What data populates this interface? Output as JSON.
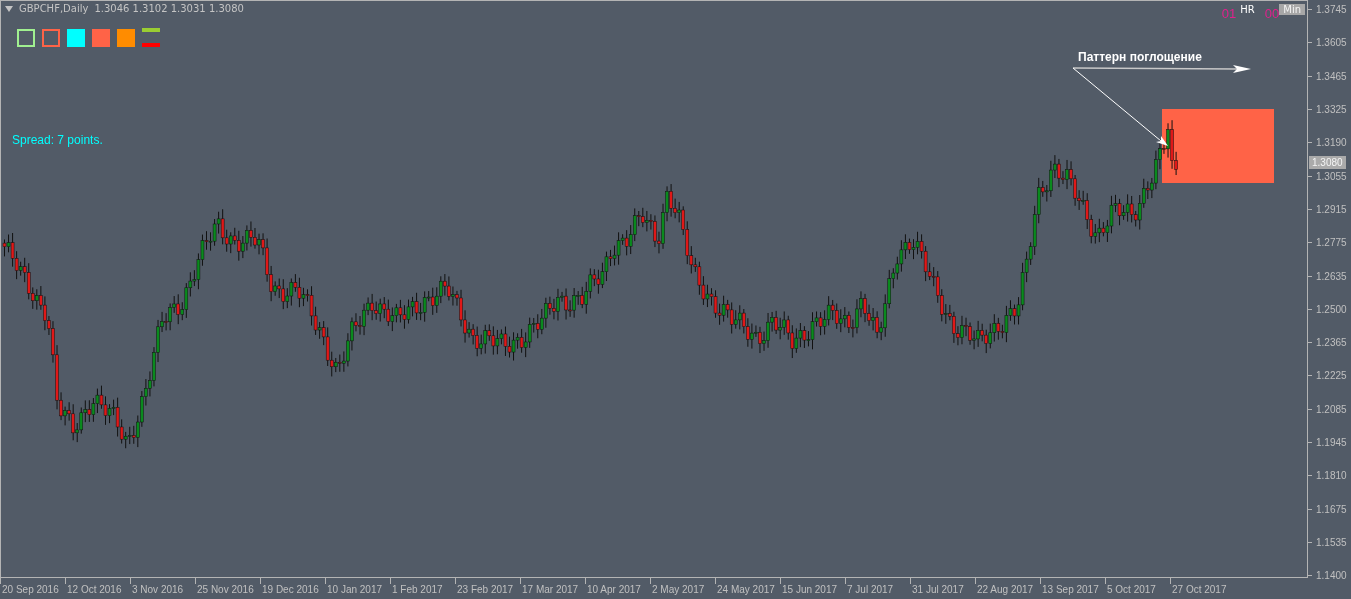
{
  "chart": {
    "symbol": "GBPCHF,Daily",
    "ohlc": "1.3046 1.3102 1.3031 1.3080",
    "legend": [
      {
        "kind": "outline",
        "color": "#a0f090"
      },
      {
        "kind": "outline",
        "color": "#ff6347"
      },
      {
        "kind": "filled",
        "color": "#00ffff"
      },
      {
        "kind": "filled",
        "color": "#ff6347"
      },
      {
        "kind": "filled",
        "color": "#ff8c00"
      },
      {
        "kind": "bar",
        "color": "#9acd32"
      },
      {
        "kind": "bar",
        "color": "#ff0000"
      }
    ],
    "spread": "Spread: 7 points.",
    "timer": {
      "hours": "01",
      "hours_unit": "HR",
      "minutes": "00",
      "minutes_unit": "Min"
    },
    "annotation": "Паттерн поглощение",
    "current_price": "1.3080",
    "price_axis": [
      "1.3745",
      "1.3605",
      "1.3465",
      "1.3325",
      "1.3190",
      "1.3055",
      "1.2915",
      "1.2775",
      "1.2635",
      "1.2500",
      "1.2365",
      "1.2225",
      "1.2085",
      "1.1945",
      "1.1810",
      "1.1675",
      "1.1535",
      "1.1400"
    ],
    "time_axis": [
      "20 Sep 2016",
      "12 Oct 2016",
      "3 Nov 2016",
      "25 Nov 2016",
      "19 Dec 2016",
      "10 Jan 2017",
      "1 Feb 2017",
      "23 Feb 2017",
      "17 Mar 2017",
      "10 Apr 2017",
      "2 May 2017",
      "24 May 2017",
      "15 Jun 2017",
      "7 Jul 2017",
      "31 Jul 2017",
      "22 Aug 2017",
      "13 Sep 2017",
      "5 Oct 2017",
      "27 Oct 2017"
    ]
  }
}
